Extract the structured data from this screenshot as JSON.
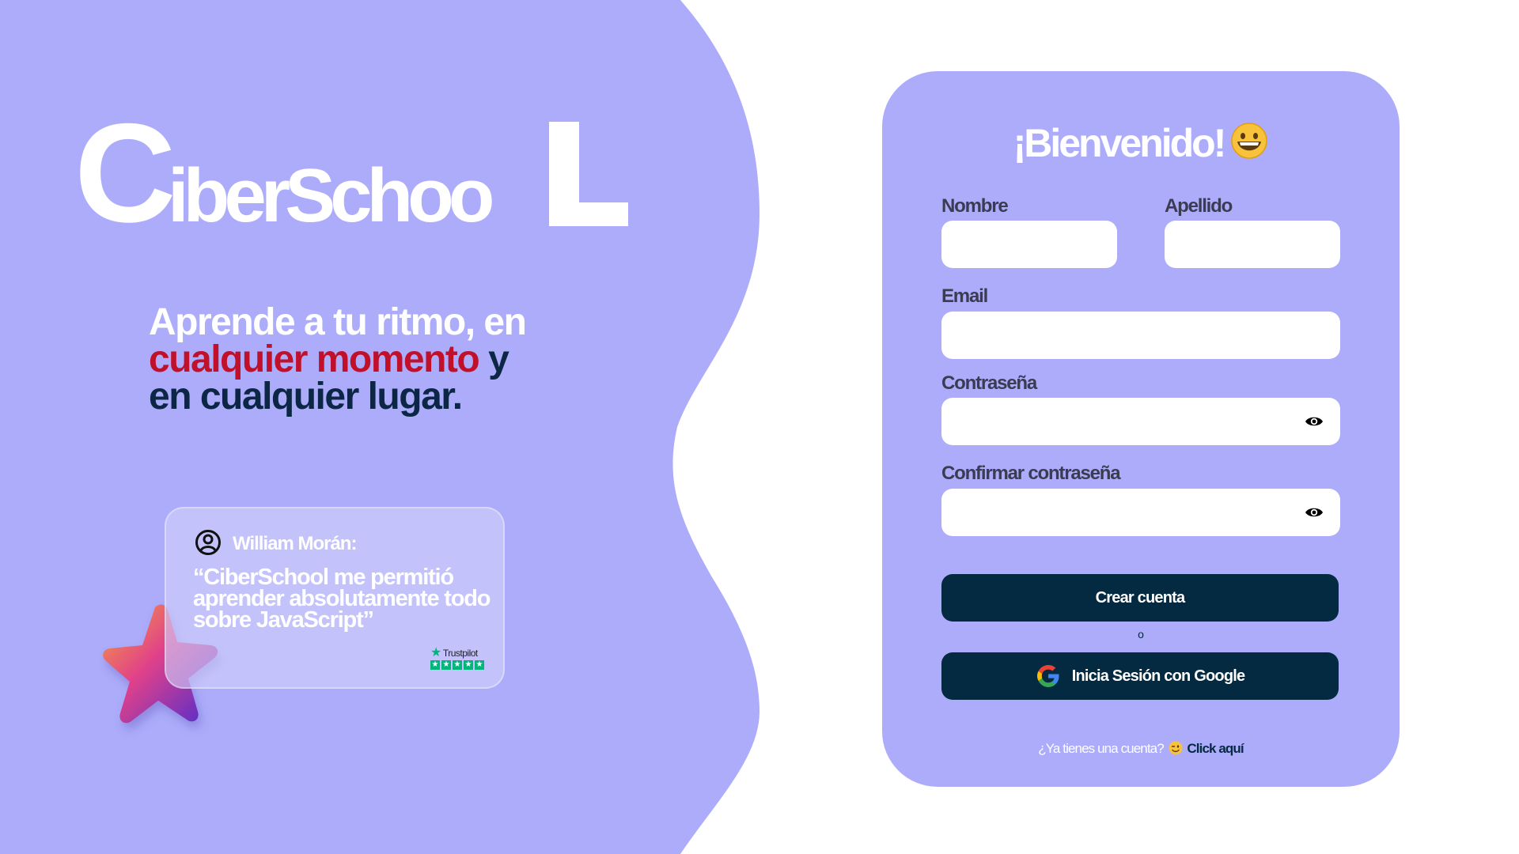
{
  "brand": {
    "logo_initial": "C",
    "logo_middle": "iberSchoo",
    "logo_final": "L",
    "logo_full": "CiberSchooL",
    "colors": {
      "primary_purple": "#acacfb",
      "dark_navy": "#032a40",
      "accent_red": "#c0102a",
      "white": "#ffffff"
    }
  },
  "hero": {
    "tagline_part1": "Aprende a tu ritmo, en",
    "tagline_red": "cualquier momento",
    "tagline_part2": " y",
    "tagline_part3": "en cualquier lugar."
  },
  "testimonial": {
    "icon": "user-circle-icon",
    "author": "William Morán:",
    "quote": "“CiberSchool me permitió aprender absolutamente todo sobre JavaScript”",
    "badge_label": "Trustpilot",
    "rating_stars": 5
  },
  "form": {
    "title": "¡Bienvenido!",
    "title_emoji": "grinning-face-icon",
    "fields": {
      "nombre": {
        "label": "Nombre",
        "value": "",
        "placeholder": ""
      },
      "apellido": {
        "label": "Apellido",
        "value": "",
        "placeholder": ""
      },
      "email": {
        "label": "Email",
        "value": "",
        "placeholder": ""
      },
      "password": {
        "label": "Contraseña",
        "value": "",
        "placeholder": "",
        "toggle_icon": "eye-icon"
      },
      "confirm_password": {
        "label": "Confirmar contraseña",
        "value": "",
        "placeholder": "",
        "toggle_icon": "eye-icon"
      }
    },
    "submit_label": "Crear cuenta",
    "or_text": "o",
    "google_label": "Inicia Sesión con Google",
    "google_icon": "google-icon",
    "footer_question": "¿Ya tienes una cuenta?",
    "footer_emoji": "winking-face-icon",
    "footer_link": "Click aquí"
  }
}
